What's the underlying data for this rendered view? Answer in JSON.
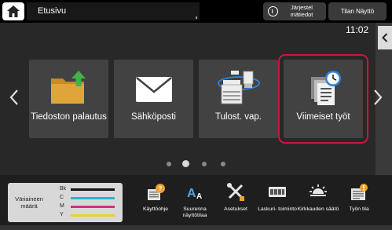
{
  "header": {
    "title": "Etusivu",
    "system_button_label": "Järjestel mätiedot",
    "status_button_label": "Tilan Näyttö"
  },
  "clock": "11:02",
  "tiles": [
    {
      "label": "Tiedoston palautus",
      "icon": "folder-upload-icon"
    },
    {
      "label": "Sähköposti",
      "icon": "envelope-icon"
    },
    {
      "label": "Tulost. vap.",
      "icon": "printer-release-icon"
    },
    {
      "label": "Viimeiset työt",
      "icon": "recent-jobs-icon",
      "selected": true
    }
  ],
  "pager": {
    "pages": 4,
    "current": 2
  },
  "toner": {
    "title": "Väriaineen määrä",
    "levels": [
      {
        "name": "Bk",
        "color": "#111111"
      },
      {
        "name": "C",
        "color": "#29b6c8"
      },
      {
        "name": "M",
        "color": "#d1307f"
      },
      {
        "name": "Y",
        "color": "#e8d22a"
      }
    ]
  },
  "bottom_items": [
    {
      "label": "Käyttöohje",
      "icon": "help-guide-icon"
    },
    {
      "label": "Suurenna näyttötilaa",
      "icon": "enlarge-text-icon"
    },
    {
      "label": "Asetukset",
      "icon": "settings-tools-icon"
    },
    {
      "label": "Laskuri- toiminto",
      "icon": "counter-icon"
    },
    {
      "label": "Kirkkauden säätö",
      "icon": "brightness-icon"
    },
    {
      "label": "Työn tila",
      "icon": "job-status-icon"
    }
  ],
  "colors": {
    "selection": "#c9173b",
    "folder": "#e0a53a",
    "upload_arrow": "#3fb24a",
    "clock_badge": "#2f86d8"
  }
}
